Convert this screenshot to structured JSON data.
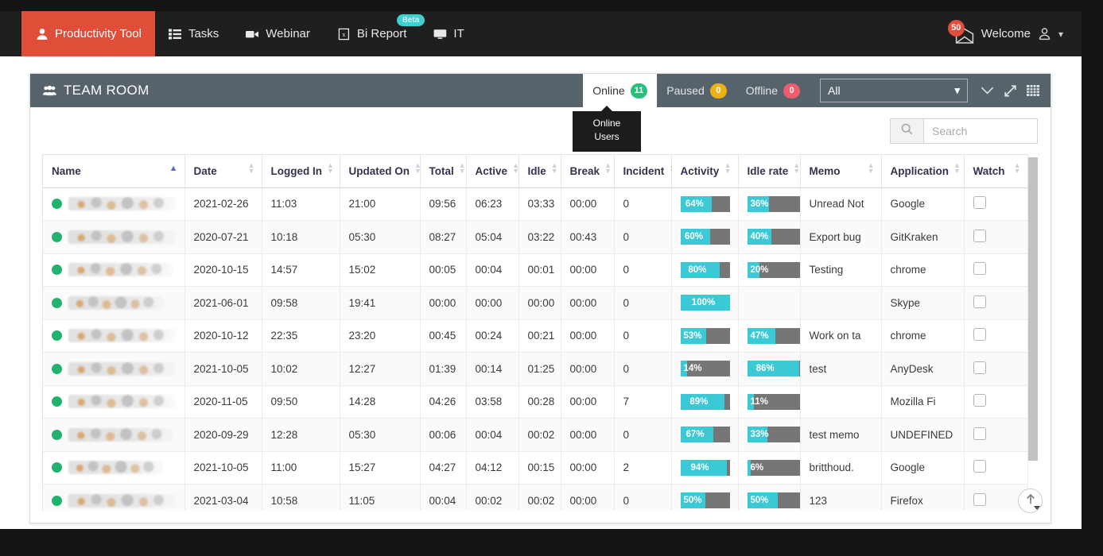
{
  "navbar": {
    "tabs": [
      {
        "label": "Productivity Tool",
        "icon": "user-icon",
        "active": true
      },
      {
        "label": "Tasks",
        "icon": "list-icon",
        "active": false
      },
      {
        "label": "Webinar",
        "icon": "video-camera-icon",
        "active": false
      },
      {
        "label": "Bi Report",
        "icon": "file-report-icon",
        "active": false,
        "badge": "Beta"
      },
      {
        "label": "IT",
        "icon": "monitor-icon",
        "active": false
      }
    ],
    "mail_count": "50",
    "welcome_label": "Welcome"
  },
  "panel": {
    "title": "TEAM ROOM",
    "status_tabs": [
      {
        "label": "Online",
        "count": "11",
        "color": "#27c07a",
        "selected": true
      },
      {
        "label": "Paused",
        "count": "0",
        "color": "#edb111",
        "selected": false
      },
      {
        "label": "Offline",
        "count": "0",
        "color": "#f15b6e",
        "selected": false
      }
    ],
    "tooltip": {
      "line1": "Online",
      "line2": "Users"
    },
    "filter_select": {
      "value": "All"
    },
    "search": {
      "value": "",
      "placeholder": "Search"
    }
  },
  "table": {
    "columns": [
      {
        "label": "Name",
        "sort": "asc"
      },
      {
        "label": "Date",
        "sort": "none"
      },
      {
        "label": "Logged In",
        "sort": "none"
      },
      {
        "label": "Updated On",
        "sort": "none"
      },
      {
        "label": "Total",
        "sort": "none"
      },
      {
        "label": "Active",
        "sort": "none"
      },
      {
        "label": "Idle",
        "sort": "none"
      },
      {
        "label": "Break",
        "sort": "none"
      },
      {
        "label": "Incident",
        "sort": "none"
      },
      {
        "label": "Activity",
        "sort": "none"
      },
      {
        "label": "Idle rate",
        "sort": "none"
      },
      {
        "label": "Memo",
        "sort": "none"
      },
      {
        "label": "Application",
        "sort": "none"
      },
      {
        "label": "Watch",
        "sort": "none"
      }
    ],
    "rows": [
      {
        "status": "online",
        "date": "2021-02-26",
        "logged_in": "11:03",
        "updated_on": "21:00",
        "total": "09:56",
        "active": "06:23",
        "idle": "03:33",
        "break": "00:00",
        "incident": "0",
        "activity": "64%",
        "idle_rate": "36%",
        "memo": "Unread Not",
        "application": "Google",
        "watch": false
      },
      {
        "status": "online",
        "date": "2020-07-21",
        "logged_in": "10:18",
        "updated_on": "05:30",
        "total": "08:27",
        "active": "05:04",
        "idle": "03:22",
        "break": "00:43",
        "incident": "0",
        "activity": "60%",
        "idle_rate": "40%",
        "memo": "Export bug",
        "application": "GitKraken",
        "watch": false
      },
      {
        "status": "online",
        "date": "2020-10-15",
        "logged_in": "14:57",
        "updated_on": "15:02",
        "total": "00:05",
        "active": "00:04",
        "idle": "00:01",
        "break": "00:00",
        "incident": "0",
        "activity": "80%",
        "idle_rate": "20%",
        "memo": "Testing",
        "application": "chrome",
        "watch": false
      },
      {
        "status": "online",
        "date": "2021-06-01",
        "logged_in": "09:58",
        "updated_on": "19:41",
        "total": "00:00",
        "active": "00:00",
        "idle": "00:00",
        "break": "00:00",
        "incident": "0",
        "activity": "100%",
        "idle_rate": "",
        "memo": "",
        "application": "Skype",
        "watch": false
      },
      {
        "status": "online",
        "date": "2020-10-12",
        "logged_in": "22:35",
        "updated_on": "23:20",
        "total": "00:45",
        "active": "00:24",
        "idle": "00:21",
        "break": "00:00",
        "incident": "0",
        "activity": "53%",
        "idle_rate": "47%",
        "memo": "Work on ta",
        "application": "chrome",
        "watch": false
      },
      {
        "status": "online",
        "date": "2021-10-05",
        "logged_in": "10:02",
        "updated_on": "12:27",
        "total": "01:39",
        "active": "00:14",
        "idle": "01:25",
        "break": "00:00",
        "incident": "0",
        "activity": "14%",
        "idle_rate": "86%",
        "memo": "test",
        "application": "AnyDesk",
        "watch": false
      },
      {
        "status": "online",
        "date": "2020-11-05",
        "logged_in": "09:50",
        "updated_on": "14:28",
        "total": "04:26",
        "active": "03:58",
        "idle": "00:28",
        "break": "00:00",
        "incident": "7",
        "activity": "89%",
        "idle_rate": "11%",
        "memo": "",
        "application": "Mozilla Fi",
        "watch": false
      },
      {
        "status": "online",
        "date": "2020-09-29",
        "logged_in": "12:28",
        "updated_on": "05:30",
        "total": "00:06",
        "active": "00:04",
        "idle": "00:02",
        "break": "00:00",
        "incident": "0",
        "activity": "67%",
        "idle_rate": "33%",
        "memo": "test memo",
        "application": "UNDEFINED",
        "watch": false
      },
      {
        "status": "online",
        "date": "2021-10-05",
        "logged_in": "11:00",
        "updated_on": "15:27",
        "total": "04:27",
        "active": "04:12",
        "idle": "00:15",
        "break": "00:00",
        "incident": "2",
        "activity": "94%",
        "idle_rate": "6%",
        "memo": "britthoud.",
        "application": "Google",
        "watch": false
      },
      {
        "status": "online",
        "date": "2021-03-04",
        "logged_in": "10:58",
        "updated_on": "11:05",
        "total": "00:04",
        "active": "00:02",
        "idle": "00:02",
        "break": "00:00",
        "incident": "0",
        "activity": "50%",
        "idle_rate": "50%",
        "memo": "123",
        "application": "Firefox",
        "watch": false
      }
    ]
  },
  "colors": {
    "accent_red": "#e04e39",
    "panel_header": "#56636b",
    "bar_fill": "#3bc9d6",
    "bar_track": "#767676",
    "online_green": "#23b26d"
  }
}
